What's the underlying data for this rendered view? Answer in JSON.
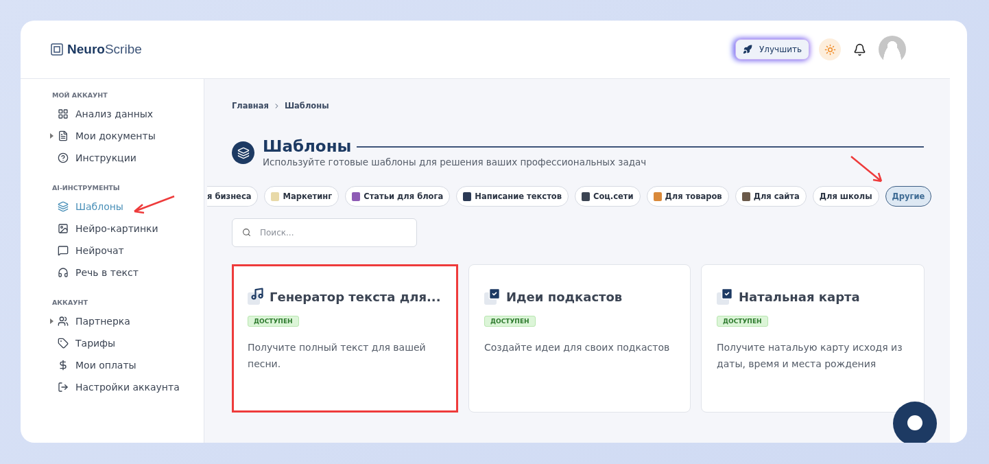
{
  "logo": {
    "bold": "Neuro",
    "light": "Scribe"
  },
  "header": {
    "upgrade_button": "Улучшить"
  },
  "sidebar": {
    "sections": [
      {
        "title": "МОЙ АККАУНТ",
        "items": [
          {
            "label": "Анализ данных",
            "expandable": false,
            "selected": false,
            "annotated": false
          },
          {
            "label": "Мои документы",
            "expandable": true,
            "selected": false,
            "annotated": false
          },
          {
            "label": "Инструкции",
            "expandable": false,
            "selected": false,
            "annotated": false
          }
        ]
      },
      {
        "title": "AI-ИНСТРУМЕНТЫ",
        "items": [
          {
            "label": "Шаблоны",
            "expandable": false,
            "selected": true,
            "annotated": true
          },
          {
            "label": "Нейро-картинки",
            "expandable": false,
            "selected": false,
            "annotated": false
          },
          {
            "label": "Нейрочат",
            "expandable": false,
            "selected": false,
            "annotated": false
          },
          {
            "label": "Речь в текст",
            "expandable": false,
            "selected": false,
            "annotated": false
          }
        ]
      },
      {
        "title": "АККАУНТ",
        "items": [
          {
            "label": "Партнерка",
            "expandable": true,
            "selected": false,
            "annotated": false
          },
          {
            "label": "Тарифы",
            "expandable": false,
            "selected": false,
            "annotated": false
          },
          {
            "label": "Мои оплаты",
            "expandable": false,
            "selected": false,
            "annotated": false
          },
          {
            "label": "Настройки аккаунта",
            "expandable": false,
            "selected": false,
            "annotated": false
          }
        ]
      }
    ]
  },
  "breadcrumb": [
    "Главная",
    "Шаблоны"
  ],
  "page": {
    "title": "Шаблоны",
    "subtitle": "Используйте готовые шаблоны для решения ваших профессиональных задач"
  },
  "categories": [
    {
      "label": "я бизнеса",
      "selected": false
    },
    {
      "label": "Маркетинг",
      "selected": false,
      "color": "#e8d9a8"
    },
    {
      "label": "Статьи для блога",
      "selected": false,
      "color": "#8e5bb5"
    },
    {
      "label": "Написание текстов",
      "selected": false,
      "color": "#2b3a55"
    },
    {
      "label": "Соц.сети",
      "selected": false,
      "color": "#3b4452"
    },
    {
      "label": "Для товаров",
      "selected": false,
      "color": "#d9893a"
    },
    {
      "label": "Для сайта",
      "selected": false,
      "color": "#6b5a4a"
    },
    {
      "label": "Для школы",
      "selected": false
    },
    {
      "label": "Другие",
      "selected": true
    }
  ],
  "search": {
    "placeholder": "Поиск..."
  },
  "cards": [
    {
      "kind": "music",
      "title": "Генератор текста для...",
      "badge": "ДОСТУПЕН",
      "description": "Получите полный текст для вашей песни.",
      "highlighted": true
    },
    {
      "kind": "check",
      "title": "Идеи подкастов",
      "badge": "ДОСТУПЕН",
      "description": "Создайте идеи для своих подкастов",
      "highlighted": false
    },
    {
      "kind": "check",
      "title": "Натальная карта",
      "badge": "ДОСТУПЕН",
      "description": "Получите натальую карту исходя из даты, время и места рождения",
      "highlighted": false
    }
  ]
}
